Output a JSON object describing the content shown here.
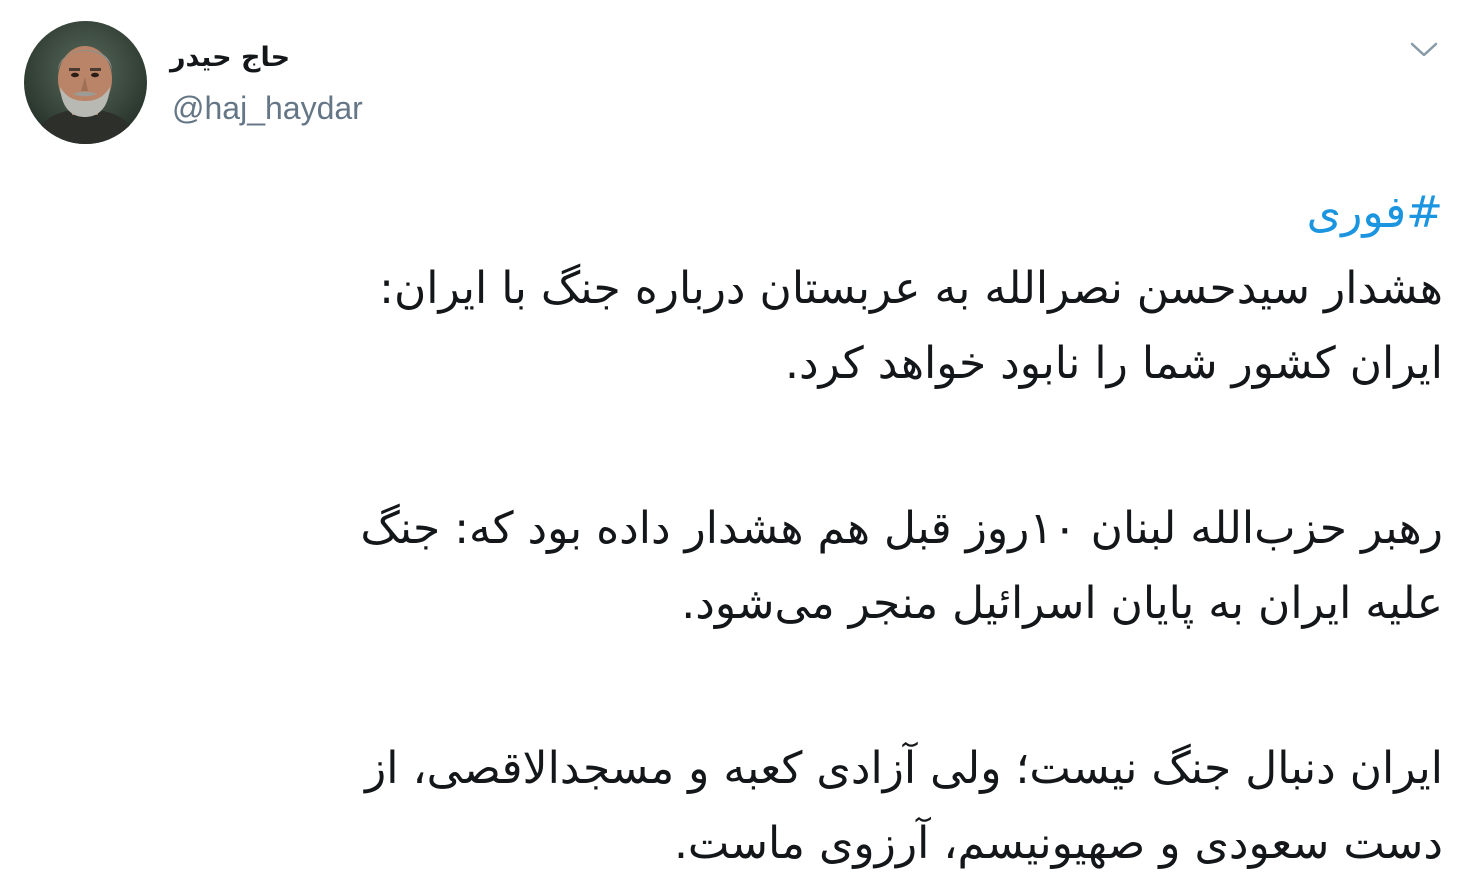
{
  "tweet": {
    "author": {
      "display_name": "حاج حیدر",
      "handle": "@haj_haydar"
    },
    "menu_icon": "chevron-down-icon",
    "hashtag": "#فوری",
    "paragraphs": [
      {
        "line1": "هشدار سیدحسن نصرالله به عربستان درباره جنگ با ایران:",
        "line2": "ایران کشور شما را نابود خواهد کرد."
      },
      {
        "line1": "رهبر حزب‌الله لبنان ۱۰روز قبل هم هشدار داده بود که: جنگ",
        "line2": "علیه ایران به پایان اسرائیل منجر می‌شود."
      },
      {
        "line1": "ایران دنبال جنگ نیست؛ ولی آزادی کعبه و مسجدالاقصی، از",
        "line2": "دست سعودی و صهیونیسم، آرزوی ماست."
      }
    ],
    "colors": {
      "hashtag": "#1b95e0",
      "text": "#14171a",
      "handle": "#657786"
    }
  }
}
